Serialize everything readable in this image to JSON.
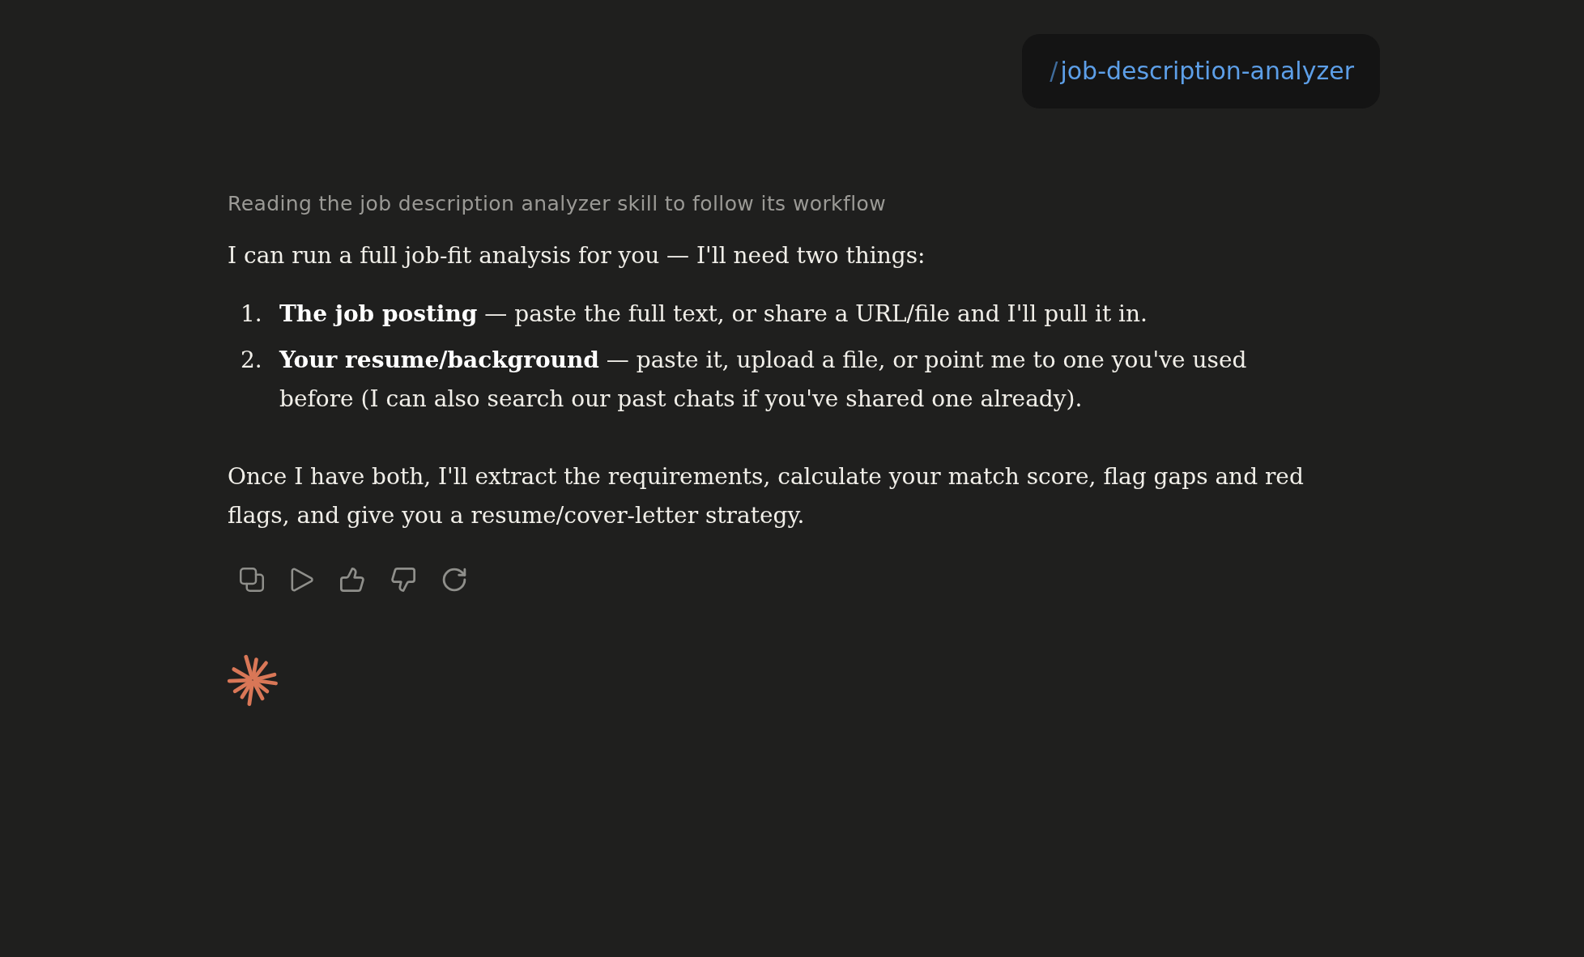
{
  "user_message": {
    "slash": "/",
    "command": "job-description-analyzer"
  },
  "assistant": {
    "status": "Reading the job description analyzer skill to follow its workflow",
    "intro": "I can run a full job-fit analysis for you — I'll need two things:",
    "items": [
      {
        "number": "1.",
        "text": "**The job posting** — paste the full text, or share a URL/file and I'll pull it in."
      },
      {
        "number": "2.",
        "text": "**Your resume/background** — paste it, upload a file, or point me to one you've used before (I can also search our past chats if you've shared one already)."
      }
    ],
    "closing": "Once I have both, I'll extract the requirements, calculate your match score, flag gaps and red flags, and give you a resume/cover-letter strategy."
  }
}
